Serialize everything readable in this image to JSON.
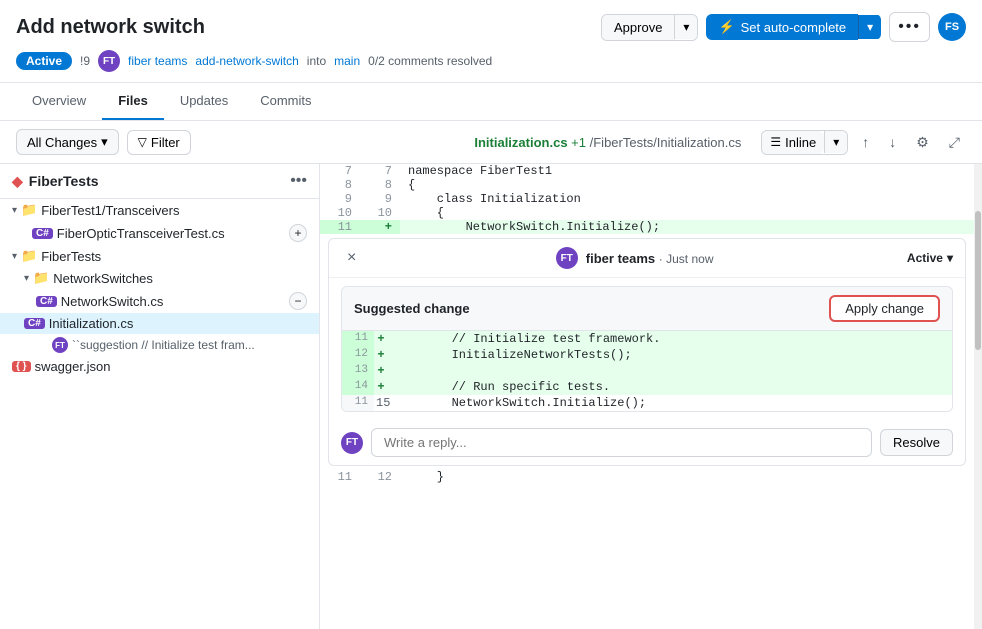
{
  "header": {
    "title": "Add network switch",
    "badge": "Active",
    "issue_count": "!9",
    "author": "fiber teams",
    "branch_from": "add-network-switch",
    "branch_to": "main",
    "comments_resolved": "0/2 comments resolved",
    "approve_label": "Approve",
    "autocomplete_label": "Set auto-complete",
    "avatar_fs": "FS",
    "avatar_ft": "FT"
  },
  "nav": {
    "tabs": [
      {
        "label": "Overview",
        "active": false
      },
      {
        "label": "Files",
        "active": true
      },
      {
        "label": "Updates",
        "active": false
      },
      {
        "label": "Commits",
        "active": false
      }
    ]
  },
  "toolbar": {
    "all_changes_label": "All Changes",
    "filter_label": "Filter",
    "filename": "Initialization.cs",
    "file_added": "+1",
    "file_path": "/FiberTests/Initialization.cs",
    "inline_label": "Inline"
  },
  "sidebar": {
    "title": "FiberTests",
    "tree": [
      {
        "type": "folder",
        "label": "FiberTest1/Transceivers",
        "indent": 0,
        "expanded": true
      },
      {
        "type": "file",
        "label": "FiberOpticTransceiverTest.cs",
        "indent": 1,
        "lang": "cs",
        "action": "add"
      },
      {
        "type": "folder",
        "label": "FiberTests",
        "indent": 0,
        "expanded": true
      },
      {
        "type": "folder",
        "label": "NetworkSwitches",
        "indent": 1,
        "expanded": true
      },
      {
        "type": "file",
        "label": "NetworkSwitch.cs",
        "indent": 2,
        "lang": "cs",
        "action": "minus"
      },
      {
        "type": "file",
        "label": "Initialization.cs",
        "indent": 1,
        "lang": "cs",
        "active": true
      },
      {
        "type": "suggestion",
        "label": "``suggestion // Initialize test fram...",
        "indent": 2
      },
      {
        "type": "file",
        "label": "swagger.json",
        "indent": 0,
        "lang": "json"
      }
    ]
  },
  "code": {
    "lines": [
      {
        "old_num": "7",
        "new_num": "7",
        "content": "namespace FiberTest1",
        "type": "normal"
      },
      {
        "old_num": "8",
        "new_num": "8",
        "content": "{",
        "type": "normal"
      },
      {
        "old_num": "9",
        "new_num": "9",
        "content": "    class Initialization",
        "type": "normal"
      },
      {
        "old_num": "10",
        "new_num": "10",
        "content": "    {",
        "type": "normal"
      },
      {
        "old_num": "11",
        "new_num": "+",
        "content": "        NetworkSwitch.Initialize();",
        "type": "added"
      }
    ],
    "bottom_lines": [
      {
        "old_num": "11",
        "new_num": "12",
        "content": "    }",
        "type": "normal"
      }
    ]
  },
  "comment": {
    "avatar": "FT",
    "user": "fiber teams",
    "time": "Just now",
    "status": "Active",
    "close_btn": "×",
    "suggested_change_title": "Suggested change",
    "apply_change_label": "Apply change",
    "suggested_lines": [
      {
        "old_num": "11",
        "sign": "+",
        "code": "        // Initialize test framework.",
        "type": "added"
      },
      {
        "old_num": "12",
        "sign": "+",
        "code": "        InitializeNetworkTests();",
        "type": "added"
      },
      {
        "old_num": "13",
        "sign": "+",
        "code": "",
        "type": "added"
      },
      {
        "old_num": "14",
        "sign": "+",
        "code": "        // Run specific tests.",
        "type": "added"
      },
      {
        "old_num": "11",
        "sign": " ",
        "code": "        NetworkSwitch.Initialize();",
        "type": "normal",
        "new_num": "15"
      }
    ],
    "reply_placeholder": "Write a reply...",
    "resolve_label": "Resolve"
  },
  "icons": {
    "chevron_down": "▾",
    "chevron_right": "›",
    "up_arrow": "↑",
    "down_arrow": "↓",
    "expand": "⤢",
    "settings": "⚙",
    "filter": "▾",
    "more": "•••",
    "folder": "📁",
    "close": "×",
    "lightning": "⚡"
  }
}
